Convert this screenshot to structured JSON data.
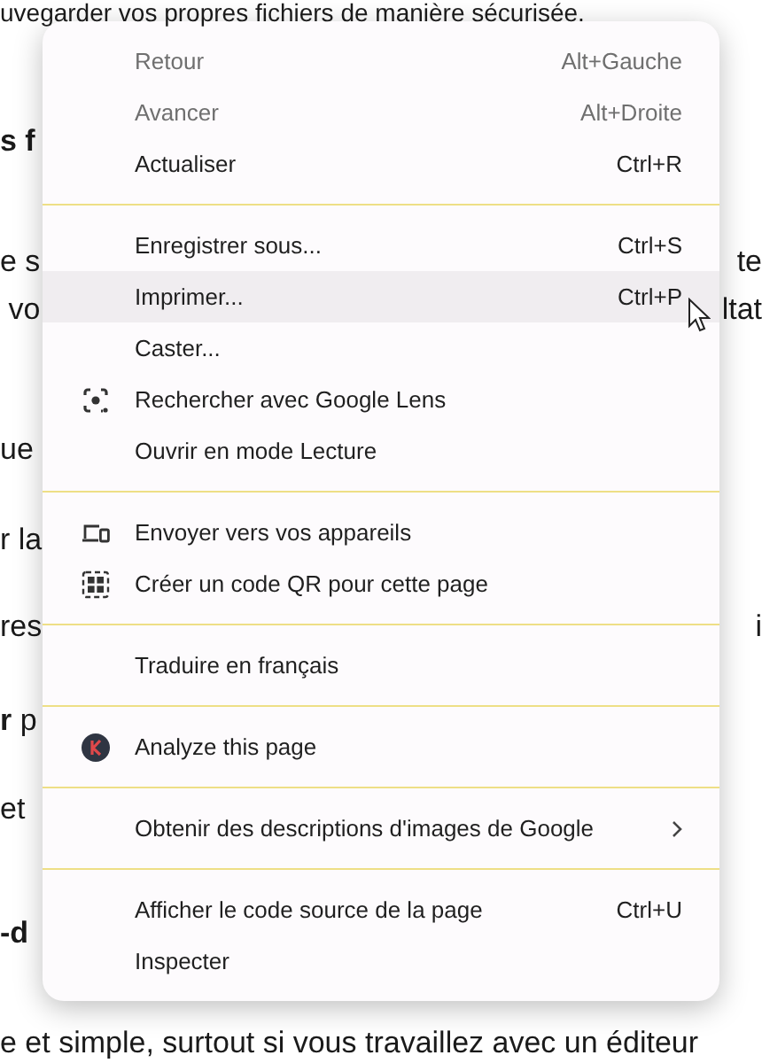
{
  "page": {
    "lines": [
      {
        "left": "uvegarder vos propres fichiers de manière sécurisée."
      },
      {
        "left": "s f",
        "bold": true
      },
      {
        "left": "e s",
        "right": "te"
      },
      {
        "left": " vo",
        "right": "ltat"
      },
      {
        "left": "ue"
      },
      {
        "left": "r la"
      },
      {
        "left": "res",
        "right": "i"
      },
      {
        "left": "**r** p"
      },
      {
        "left": "et"
      },
      {
        "left": "-d",
        "bold": true
      },
      {
        "left": "e et simple, surtout si vous travaillez avec un éditeur"
      }
    ]
  },
  "context_menu": {
    "sections": [
      {
        "items": [
          {
            "label": "Retour",
            "shortcut": "Alt+Gauche",
            "disabled": true,
            "selected": false
          },
          {
            "label": "Avancer",
            "shortcut": "Alt+Droite",
            "disabled": true,
            "selected": false
          },
          {
            "label": "Actualiser",
            "shortcut": "Ctrl+R",
            "disabled": false,
            "selected": false
          }
        ]
      },
      {
        "items": [
          {
            "label": "Enregistrer sous...",
            "shortcut": "Ctrl+S",
            "disabled": false,
            "selected": false
          },
          {
            "label": "Imprimer...",
            "shortcut": "Ctrl+P",
            "disabled": false,
            "selected": true
          },
          {
            "label": "Caster...",
            "disabled": false,
            "selected": false
          },
          {
            "label": "Rechercher avec Google Lens",
            "kind": "lens",
            "disabled": false,
            "selected": false
          },
          {
            "label": "Ouvrir en mode Lecture",
            "disabled": false,
            "selected": false
          }
        ]
      },
      {
        "items": [
          {
            "label": "Envoyer vers vos appareils",
            "kind": "devices",
            "disabled": false,
            "selected": false
          },
          {
            "label": "Créer un code QR pour cette page",
            "kind": "qr",
            "disabled": false,
            "selected": false
          }
        ]
      },
      {
        "items": [
          {
            "label": "Traduire en français",
            "disabled": false,
            "selected": false
          }
        ]
      },
      {
        "items": [
          {
            "label": "Analyze this page",
            "kind": "extension",
            "disabled": false,
            "selected": false
          }
        ]
      },
      {
        "items": [
          {
            "label": "Obtenir des descriptions d'images de Google",
            "submenu": true,
            "disabled": false,
            "selected": false
          }
        ]
      },
      {
        "items": [
          {
            "label": "Afficher le code source de la page",
            "shortcut": "Ctrl+U",
            "disabled": false,
            "selected": false
          },
          {
            "label": "Inspecter",
            "disabled": false,
            "selected": false
          }
        ]
      }
    ]
  }
}
